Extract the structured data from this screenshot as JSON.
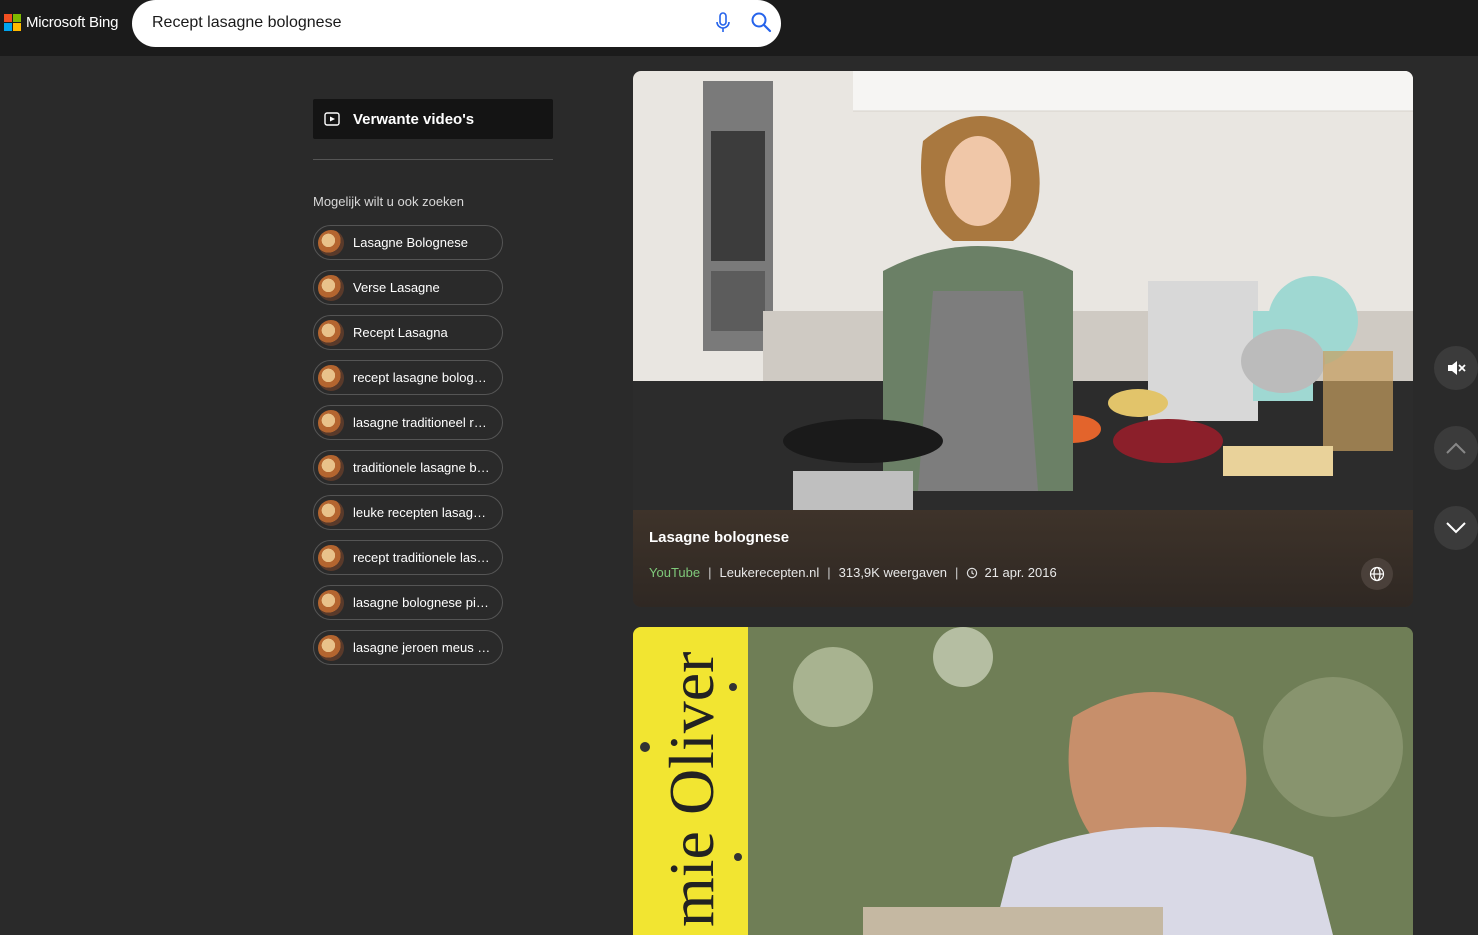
{
  "header": {
    "logo_text": "Microsoft Bing",
    "search_value": "Recept lasagne bolognese"
  },
  "sidebar": {
    "related_videos_label": "Verwante video's",
    "also_search_title": "Mogelijk wilt u ook zoeken",
    "suggestions": [
      "Lasagne Bolognese",
      "Verse Lasagne",
      "Recept Lasagna",
      "recept lasagne bolog…",
      "lasagne traditioneel r…",
      "traditionele lasagne b…",
      "leuke recepten lasag…",
      "recept traditionele las…",
      "lasagne bolognese pi…",
      "lasagne jeroen meus …"
    ]
  },
  "video1": {
    "title": "Lasagne bolognese",
    "source": "YouTube",
    "channel": "Leukerecepten.nl",
    "views": "313,9K weergaven",
    "date": "21 apr. 2016"
  },
  "video2": {
    "thumbnail_text": "mie Oliver"
  },
  "colors": {
    "topbar_bg": "#1b1b1b",
    "page_bg": "#2a2a2a",
    "youtube_green": "#7fc97a",
    "ms_red": "#f25022",
    "ms_green": "#7fba00",
    "ms_blue": "#00a4ef",
    "ms_yellow": "#ffb900"
  },
  "icons": [
    "microsoft-logo-icon",
    "mic-icon",
    "search-icon",
    "video-icon",
    "globe-icon",
    "clock-icon",
    "mute-icon",
    "chevron-up-icon",
    "chevron-down-icon"
  ]
}
